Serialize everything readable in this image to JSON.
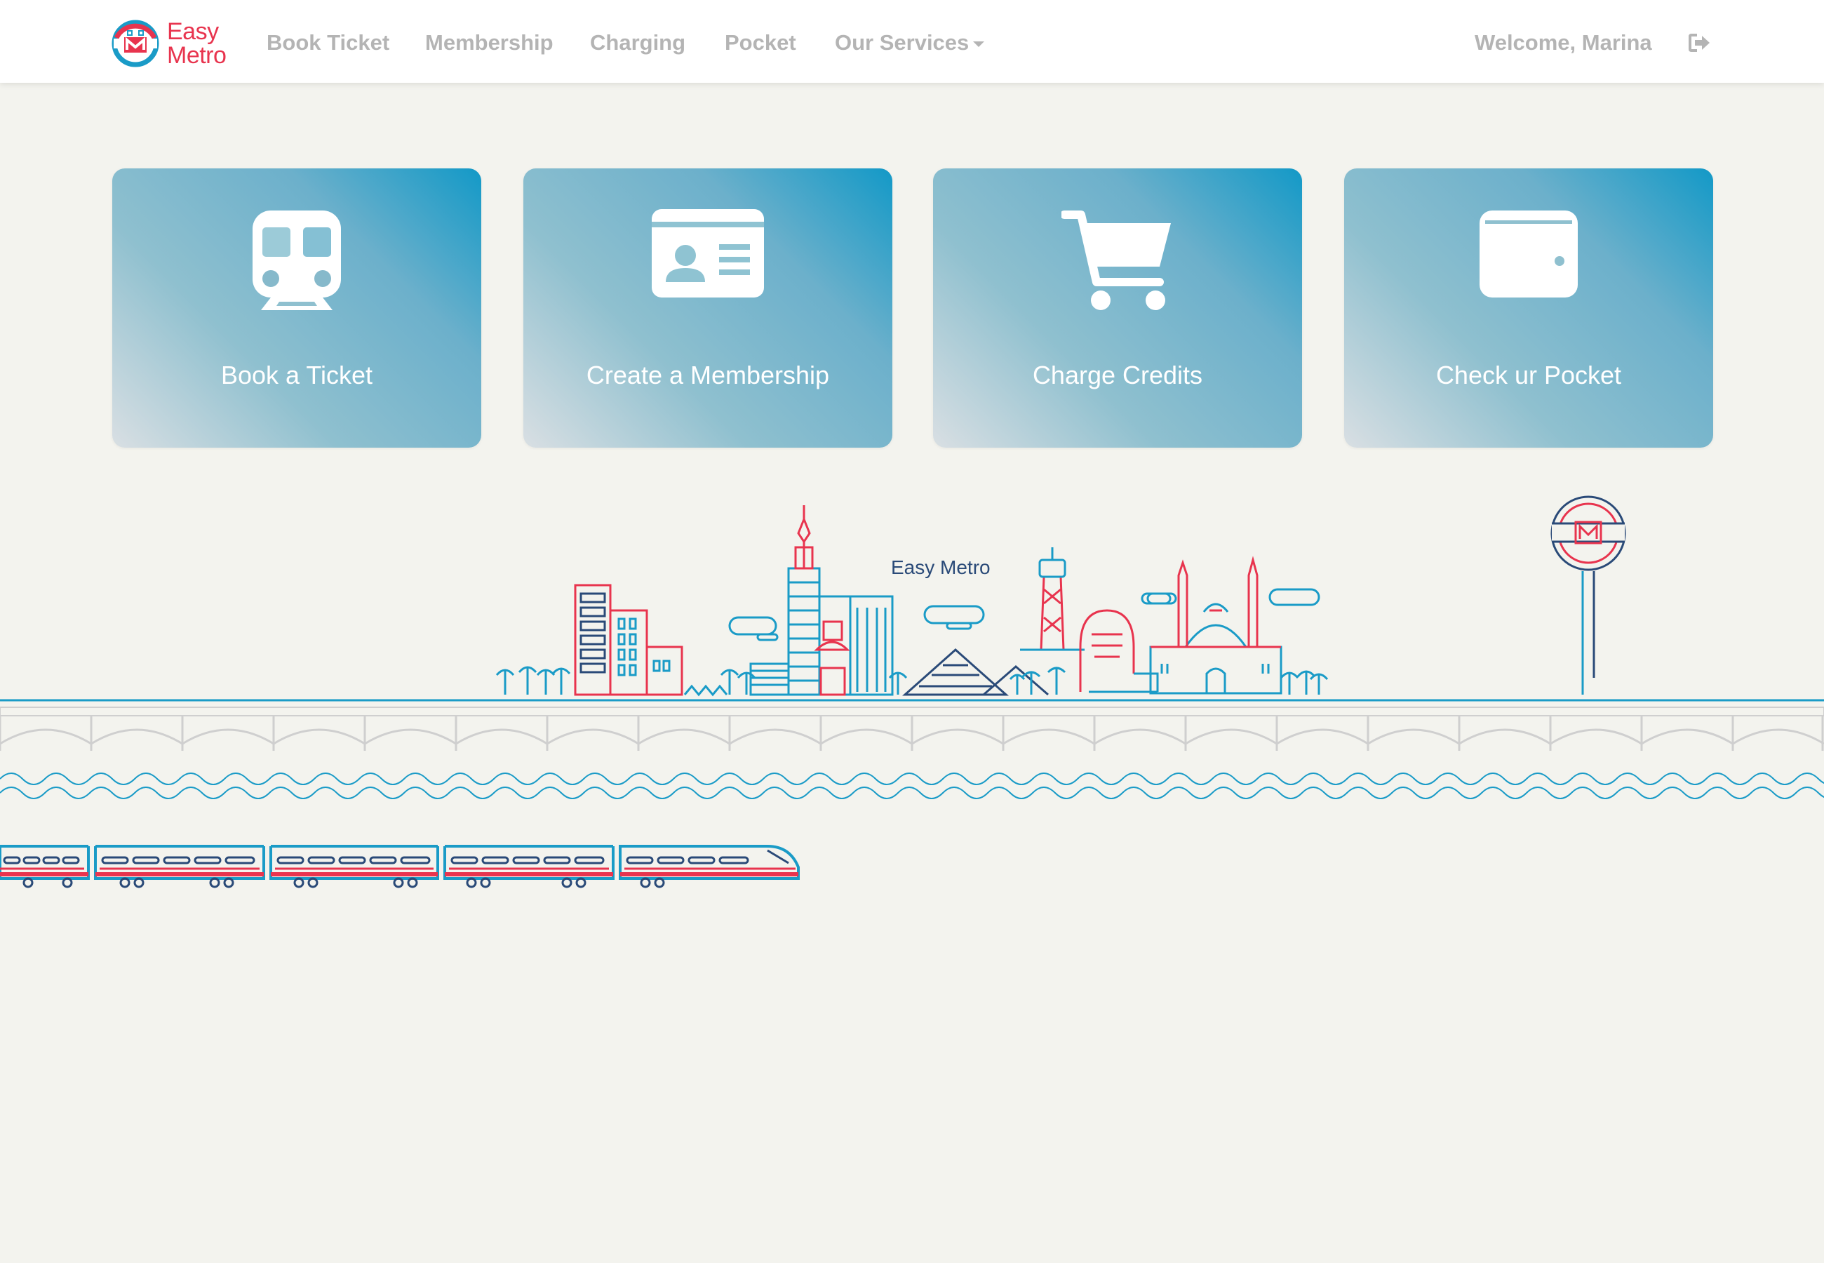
{
  "brand": {
    "line1": "Easy",
    "line2": "Metro",
    "logo": "metro-logo-icon",
    "color": "#e8344e"
  },
  "nav": {
    "links": [
      "Book Ticket",
      "Membership",
      "Charging",
      "Pocket",
      "Our Services"
    ],
    "welcome": "Welcome, Marina",
    "logout_icon": "sign-out-icon"
  },
  "cards": [
    {
      "label": "Book a Ticket",
      "icon": "train-icon"
    },
    {
      "label": "Create a Membership",
      "icon": "id-card-icon"
    },
    {
      "label": "Charge Credits",
      "icon": "shopping-cart-icon"
    },
    {
      "label": "Check ur Pocket",
      "icon": "wallet-icon"
    }
  ],
  "illustration": {
    "title": "Easy Metro"
  },
  "colors": {
    "accent_red": "#e8344e",
    "accent_blue": "#1a9bc7",
    "navy": "#2a4a78",
    "background": "#f3f3ee"
  }
}
